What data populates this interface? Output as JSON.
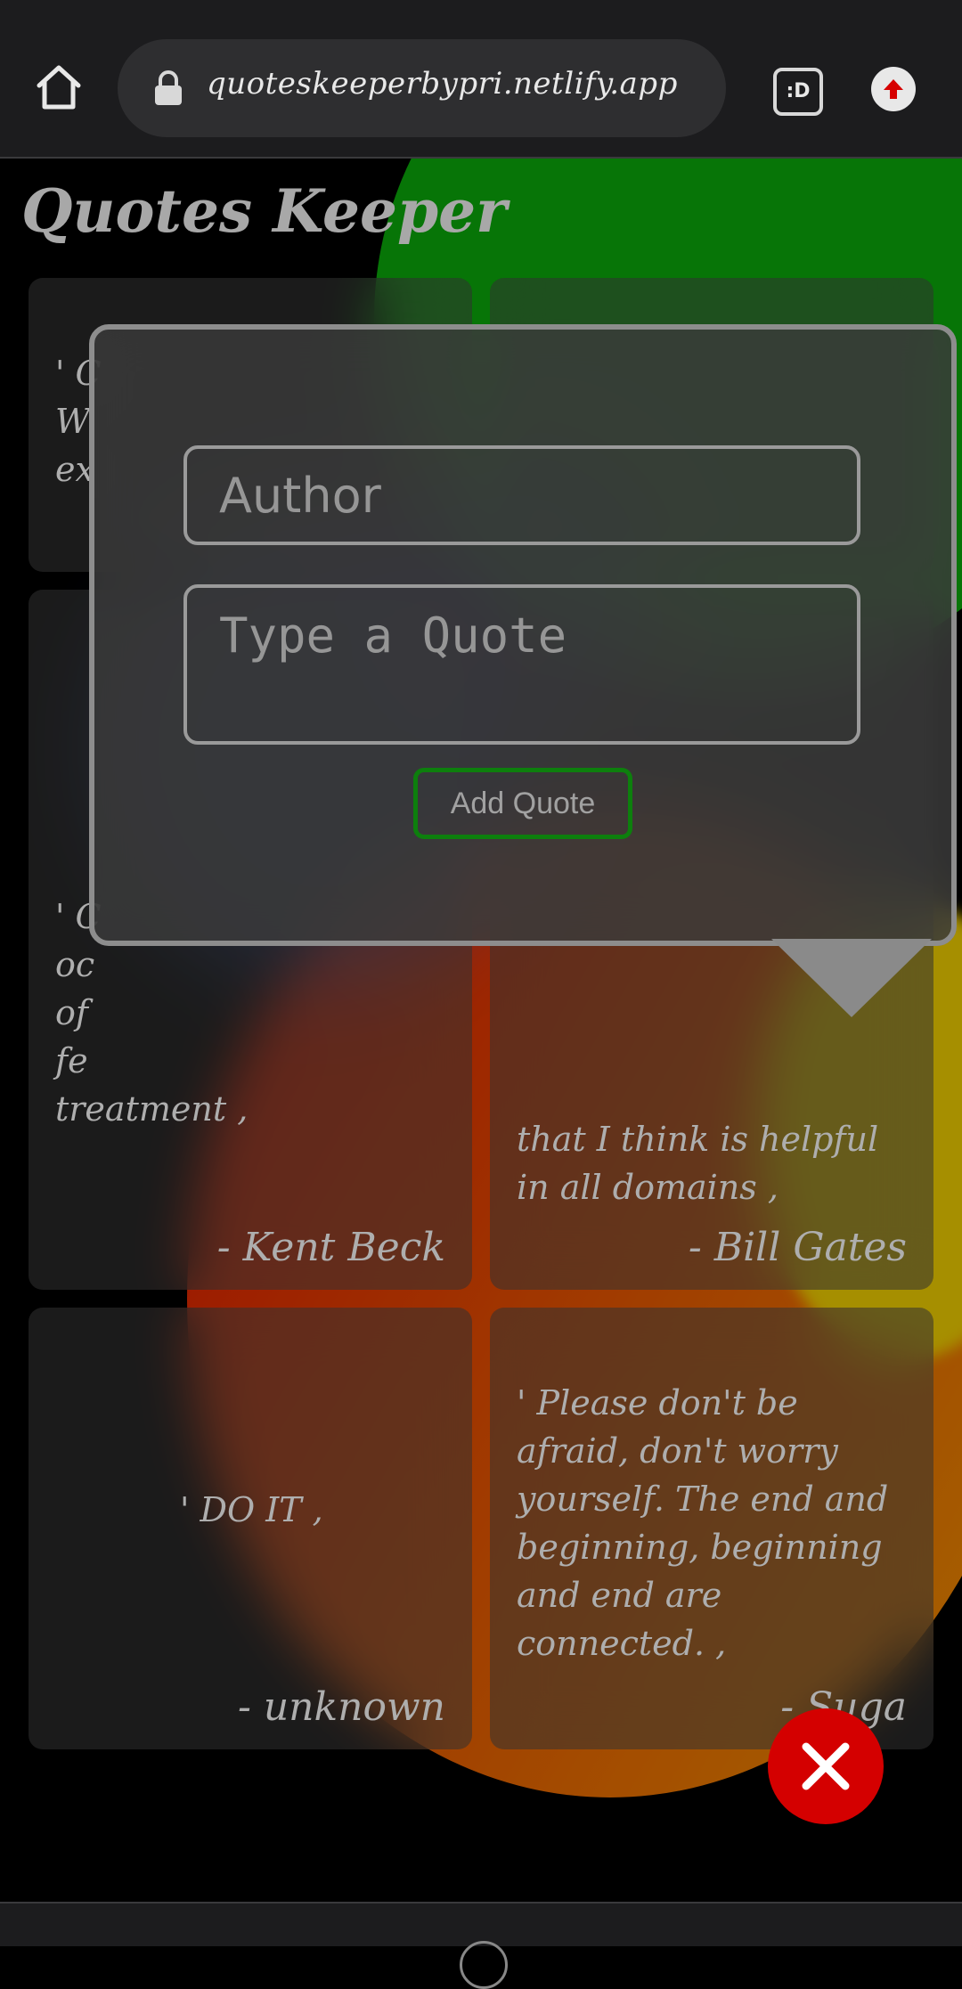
{
  "browser": {
    "url": "quoteskeeperbypri.netlify.app",
    "tabs_label": ":D",
    "icons": [
      "home-icon",
      "lock-icon",
      "tabs-icon",
      "upload-icon"
    ]
  },
  "app": {
    "title": "Quotes Keeper"
  },
  "quotes": [
    {
      "text": "' C",
      "author": "",
      "extra": "W\nex"
    },
    {
      "text": "",
      "author": ""
    },
    {
      "text": "' C\noc\nof\nfe\ntreatment ,",
      "author": "- Kent Beck"
    },
    {
      "text": "that I think is helpful\nin all domains ,",
      "author": "- Bill Gates"
    },
    {
      "text": "' DO IT ,",
      "author": "- unknown"
    },
    {
      "text": "' Please don't be afraid, don't worry yourself. The end and beginning, beginning and end are connected. ,",
      "author": "- Suga"
    }
  ],
  "modal": {
    "author_placeholder": "Author",
    "quote_placeholder": "Type a Quote",
    "add_button_label": "Add Quote"
  },
  "colors": {
    "accent_green": "#12b012",
    "close_red": "#d40000",
    "blob_green": "#0aa20a",
    "blob_orange": "#e05a00",
    "blob_yellow": "#e7c600"
  },
  "fab": {
    "icon": "close-icon"
  }
}
